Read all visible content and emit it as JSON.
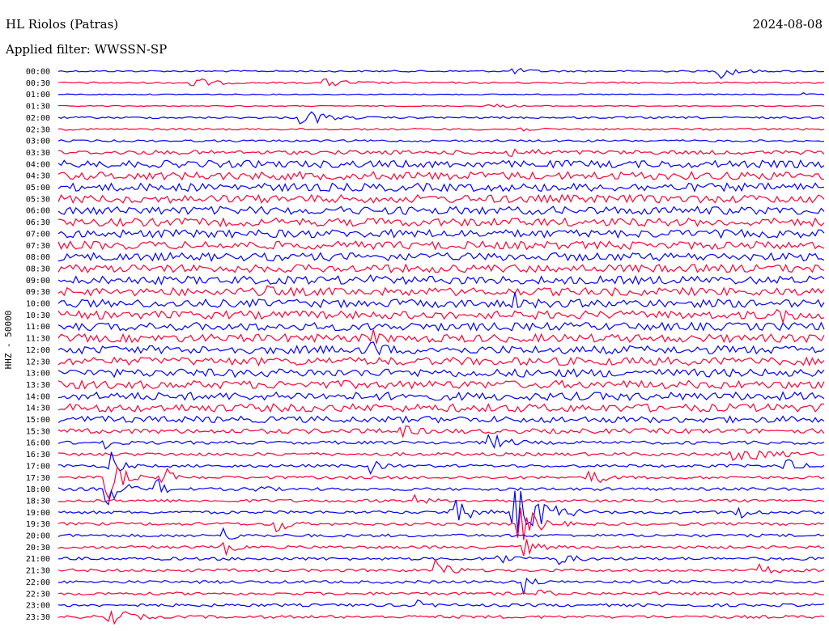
{
  "header": {
    "station": "HL Riolos (Patras)",
    "date": "2024-08-08",
    "filter": "Applied filter: WWSSN-SP"
  },
  "colors": {
    "trace_a": "#0000ff",
    "trace_b": "#ff0033",
    "background": "#ffffff"
  },
  "chart_data": {
    "type": "line",
    "title": "HL Riolos (Patras)",
    "ylabel": "HHZ - 50000",
    "xlabel": "",
    "grid": false,
    "legend": "none",
    "series_kind": "helicorder",
    "row_minutes": 30,
    "rows": [
      {
        "label": "00:00",
        "level": 1,
        "events": [
          {
            "t": 0.6,
            "amp": 3,
            "w": 0.04
          },
          {
            "t": 0.87,
            "amp": 8,
            "w": 0.04
          }
        ]
      },
      {
        "label": "00:30",
        "level": 1,
        "events": [
          {
            "t": 0.18,
            "amp": 7,
            "w": 0.04
          },
          {
            "t": 0.36,
            "amp": 4,
            "w": 0.05
          }
        ]
      },
      {
        "label": "01:00",
        "level": 0.6,
        "events": [
          {
            "t": 0.97,
            "amp": 3,
            "w": 0.01
          }
        ]
      },
      {
        "label": "01:30",
        "level": 0.6,
        "events": [
          {
            "t": 0.57,
            "amp": 2,
            "w": 0.05
          }
        ]
      },
      {
        "label": "02:00",
        "level": 1.2,
        "events": [
          {
            "t": 0.33,
            "amp": 8,
            "w": 0.05
          }
        ]
      },
      {
        "label": "02:30",
        "level": 1.2,
        "events": [
          {
            "t": 0.6,
            "amp": 4,
            "w": 0.02
          }
        ]
      },
      {
        "label": "03:00",
        "level": 1.3,
        "events": []
      },
      {
        "label": "03:30",
        "level": 2.5,
        "events": [
          {
            "t": 0.6,
            "amp": 4,
            "w": 0.05
          }
        ]
      },
      {
        "label": "04:00",
        "level": 4.5,
        "events": []
      },
      {
        "label": "04:30",
        "level": 5,
        "events": []
      },
      {
        "label": "05:00",
        "level": 5,
        "events": []
      },
      {
        "label": "05:30",
        "level": 5,
        "events": []
      },
      {
        "label": "06:00",
        "level": 5,
        "events": []
      },
      {
        "label": "06:30",
        "level": 5,
        "events": []
      },
      {
        "label": "07:00",
        "level": 5,
        "events": []
      },
      {
        "label": "07:30",
        "level": 5,
        "events": []
      },
      {
        "label": "08:00",
        "level": 5,
        "events": []
      },
      {
        "label": "08:30",
        "level": 5,
        "events": []
      },
      {
        "label": "09:00",
        "level": 5,
        "events": [
          {
            "t": 0.41,
            "amp": 10,
            "w": 0.01
          }
        ]
      },
      {
        "label": "09:30",
        "level": 5,
        "events": [
          {
            "t": 0.27,
            "amp": 12,
            "w": 0.01
          }
        ]
      },
      {
        "label": "10:00",
        "level": 5,
        "events": [
          {
            "t": 0.6,
            "amp": 10,
            "w": 0.02
          }
        ]
      },
      {
        "label": "10:30",
        "level": 5,
        "events": [
          {
            "t": 0.94,
            "amp": 10,
            "w": 0.02
          }
        ]
      },
      {
        "label": "11:00",
        "level": 5,
        "events": []
      },
      {
        "label": "11:30",
        "level": 5,
        "events": [
          {
            "t": 0.41,
            "amp": 12,
            "w": 0.01
          }
        ]
      },
      {
        "label": "12:00",
        "level": 5,
        "events": [
          {
            "t": 0.41,
            "amp": 10,
            "w": 0.02
          }
        ]
      },
      {
        "label": "12:30",
        "level": 5,
        "events": []
      },
      {
        "label": "13:00",
        "level": 5,
        "events": []
      },
      {
        "label": "13:30",
        "level": 5,
        "events": []
      },
      {
        "label": "14:00",
        "level": 5,
        "events": []
      },
      {
        "label": "14:30",
        "level": 5,
        "events": []
      },
      {
        "label": "15:00",
        "level": 4,
        "events": []
      },
      {
        "label": "15:30",
        "level": 3,
        "events": [
          {
            "t": 0.45,
            "amp": 5,
            "w": 0.03
          }
        ]
      },
      {
        "label": "16:00",
        "level": 2,
        "events": [
          {
            "t": 0.57,
            "amp": 8,
            "w": 0.04
          },
          {
            "t": 0.06,
            "amp": 10,
            "w": 0.02
          }
        ]
      },
      {
        "label": "16:30",
        "level": 2,
        "events": [
          {
            "t": 0.9,
            "amp": 6,
            "w": 0.08
          }
        ]
      },
      {
        "label": "17:00",
        "level": 1.8,
        "events": [
          {
            "t": 0.07,
            "amp": 22,
            "w": 0.02
          },
          {
            "t": 0.41,
            "amp": 8,
            "w": 0.02
          },
          {
            "t": 0.95,
            "amp": 8,
            "w": 0.03
          }
        ]
      },
      {
        "label": "17:30",
        "level": 1.8,
        "events": [
          {
            "t": 0.07,
            "amp": 24,
            "w": 0.03
          },
          {
            "t": 0.14,
            "amp": 12,
            "w": 0.02
          },
          {
            "t": 0.7,
            "amp": 8,
            "w": 0.03
          }
        ]
      },
      {
        "label": "18:00",
        "level": 1.8,
        "events": [
          {
            "t": 0.07,
            "amp": 20,
            "w": 0.03
          },
          {
            "t": 0.13,
            "amp": 12,
            "w": 0.02
          },
          {
            "t": 0.26,
            "amp": 6,
            "w": 0.02
          }
        ]
      },
      {
        "label": "18:30",
        "level": 1.8,
        "events": [
          {
            "t": 0.47,
            "amp": 6,
            "w": 0.02
          }
        ]
      },
      {
        "label": "19:00",
        "level": 1.8,
        "events": [
          {
            "t": 0.52,
            "amp": 14,
            "w": 0.04
          },
          {
            "t": 0.61,
            "amp": 30,
            "w": 0.06
          },
          {
            "t": 0.89,
            "amp": 8,
            "w": 0.03
          }
        ]
      },
      {
        "label": "19:30",
        "level": 1.8,
        "events": [
          {
            "t": 0.29,
            "amp": 14,
            "w": 0.02
          },
          {
            "t": 0.61,
            "amp": 20,
            "w": 0.04
          }
        ]
      },
      {
        "label": "20:00",
        "level": 1.8,
        "events": [
          {
            "t": 0.22,
            "amp": 8,
            "w": 0.02
          }
        ]
      },
      {
        "label": "20:30",
        "level": 1.8,
        "events": [
          {
            "t": 0.22,
            "amp": 8,
            "w": 0.02
          },
          {
            "t": 0.61,
            "amp": 10,
            "w": 0.03
          }
        ]
      },
      {
        "label": "21:00",
        "level": 1.8,
        "events": [
          {
            "t": 0.58,
            "amp": 6,
            "w": 0.03
          },
          {
            "t": 0.66,
            "amp": 6,
            "w": 0.03
          }
        ]
      },
      {
        "label": "21:30",
        "level": 1.8,
        "events": [
          {
            "t": 0.5,
            "amp": 12,
            "w": 0.03
          },
          {
            "t": 0.92,
            "amp": 6,
            "w": 0.03
          }
        ]
      },
      {
        "label": "22:00",
        "level": 1.8,
        "events": [
          {
            "t": 0.61,
            "amp": 14,
            "w": 0.02
          }
        ]
      },
      {
        "label": "22:30",
        "level": 1.8,
        "events": [
          {
            "t": 0.63,
            "amp": 6,
            "w": 0.02
          }
        ]
      },
      {
        "label": "23:00",
        "level": 1.8,
        "events": [
          {
            "t": 0.47,
            "amp": 5,
            "w": 0.02
          }
        ]
      },
      {
        "label": "23:30",
        "level": 1.8,
        "events": [
          {
            "t": 0.07,
            "amp": 12,
            "w": 0.04
          }
        ]
      }
    ]
  }
}
